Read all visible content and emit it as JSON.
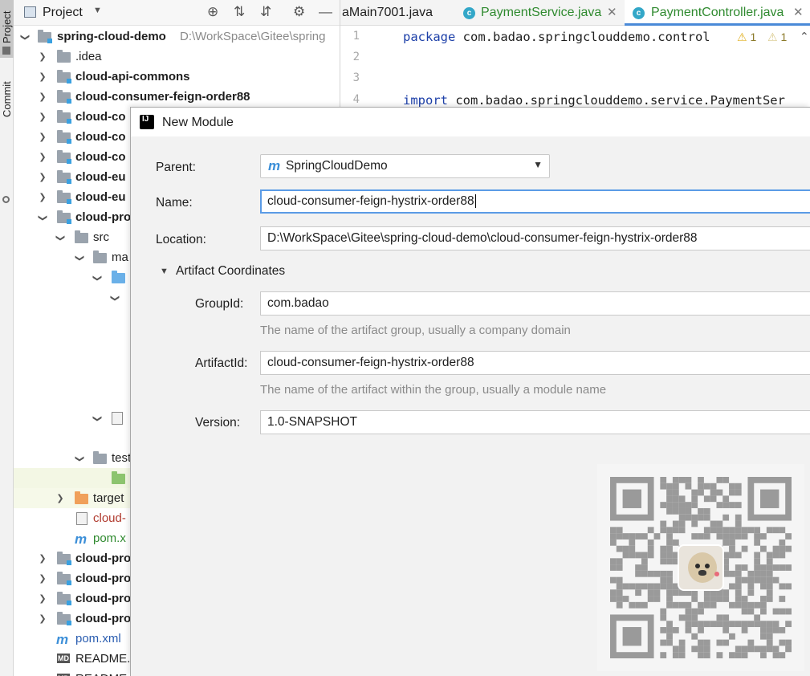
{
  "sidebar": {
    "project_tab": "Project",
    "commit_tab": "Commit"
  },
  "project_panel": {
    "title": "Project",
    "tools": [
      "crosshair-icon",
      "expand-all-icon",
      "collapse-all-icon",
      "gear-icon",
      "minimize-icon"
    ]
  },
  "tree": {
    "root": {
      "name": "spring-cloud-demo",
      "path": "D:\\WorkSpace\\Gitee\\spring"
    },
    "items": [
      {
        "label": ".idea"
      },
      {
        "label": "cloud-api-commons"
      },
      {
        "label": "cloud-consumer-feign-order88"
      },
      {
        "label": "cloud-co"
      },
      {
        "label": "cloud-co"
      },
      {
        "label": "cloud-co"
      },
      {
        "label": "cloud-eu"
      },
      {
        "label": "cloud-eu"
      },
      {
        "label": "cloud-pro"
      },
      {
        "label": "src"
      },
      {
        "label": "ma"
      },
      {
        "label": "test"
      },
      {
        "label": "target"
      },
      {
        "label": "cloud-"
      },
      {
        "label": "pom.x"
      },
      {
        "label": "cloud-pro"
      },
      {
        "label": "cloud-pro"
      },
      {
        "label": "cloud-pro"
      },
      {
        "label": "cloud-pro"
      },
      {
        "label": "pom.xml"
      },
      {
        "label": "README."
      },
      {
        "label": "README"
      }
    ]
  },
  "editor": {
    "tabs": [
      {
        "label": "aMain7001.java"
      },
      {
        "label": "PaymentService.java"
      },
      {
        "label": "PaymentController.java"
      }
    ],
    "line_numbers": [
      "1",
      "2",
      "3",
      "4"
    ],
    "code": {
      "line1_kw": "package",
      "line1_rest": "com.badao.springclouddemo.control",
      "line4_kw": "import",
      "line4_rest": "com.badao.springclouddemo.service.PaymentSer"
    },
    "warnings": {
      "warn_count": "1",
      "weak_warn_count": "1"
    }
  },
  "dialog": {
    "title": "New Module",
    "parent_label": "Parent:",
    "parent_value": "SpringCloudDemo",
    "name_label": "Name:",
    "name_value": "cloud-consumer-feign-hystrix-order88",
    "location_label": "Location:",
    "location_value": "D:\\WorkSpace\\Gitee\\spring-cloud-demo\\cloud-consumer-feign-hystrix-order88",
    "section_title": "Artifact Coordinates",
    "groupid_label": "GroupId:",
    "groupid_value": "com.badao",
    "groupid_hint": "The name of the artifact group, usually a company domain",
    "artifactid_label": "ArtifactId:",
    "artifactid_value": "cloud-consumer-feign-hystrix-order88",
    "artifactid_hint": "The name of the artifact within the group, usually a module name",
    "version_label": "Version:",
    "version_value": "1.0-SNAPSHOT"
  },
  "colors": {
    "accent": "#4a8ad8",
    "module_blue": "#39a0e0",
    "java_file": "#33a7c8"
  }
}
